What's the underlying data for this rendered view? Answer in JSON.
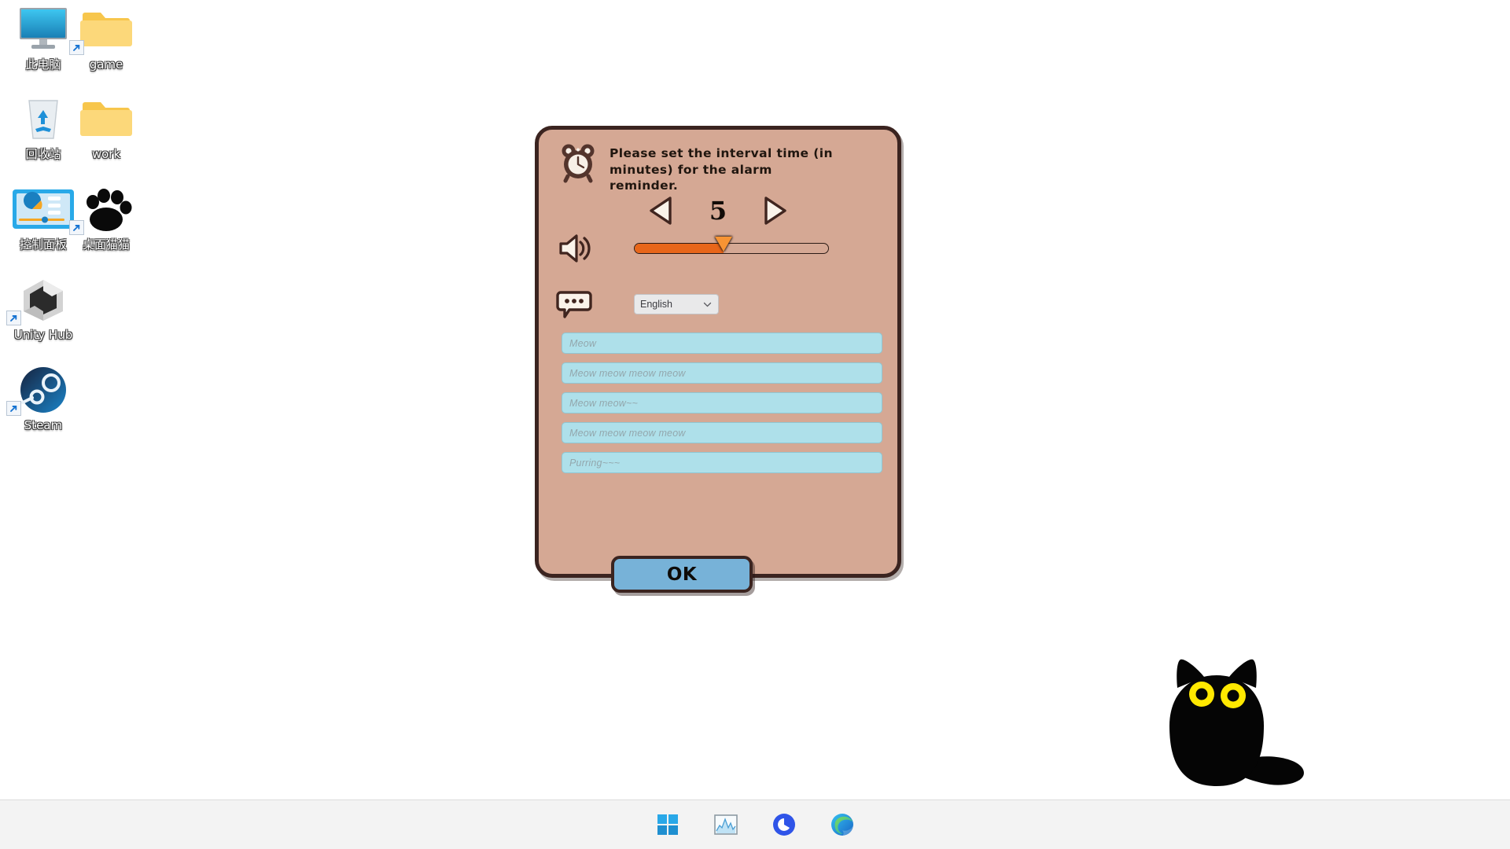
{
  "desktop": {
    "icons": [
      {
        "label": "此电脑",
        "icon": "monitor-icon",
        "shortcut": false
      },
      {
        "label": "game",
        "icon": "folder-icon",
        "shortcut": true
      },
      {
        "label": "回收站",
        "icon": "recycle-bin-icon",
        "shortcut": false
      },
      {
        "label": "work",
        "icon": "folder-icon",
        "shortcut": false
      },
      {
        "label": "控制面板",
        "icon": "control-panel-icon",
        "shortcut": false
      },
      {
        "label": "桌面猫猫",
        "icon": "paw-icon",
        "shortcut": true
      },
      {
        "label": "Unity Hub",
        "icon": "unity-icon",
        "shortcut": true
      },
      {
        "label": "Steam",
        "icon": "steam-icon",
        "shortcut": true
      }
    ]
  },
  "dialog": {
    "icon": "alarm-clock-icon",
    "message": "Please set the interval time (in minutes) for the alarm reminder.",
    "interval": {
      "value": "5",
      "decrement_icon": "triangle-left-icon",
      "increment_icon": "triangle-right-icon"
    },
    "volume": {
      "icon": "speaker-icon",
      "percent": 46
    },
    "language": {
      "icon": "speech-bubble-icon",
      "selected": "English",
      "chevron_icon": "chevron-down-icon"
    },
    "fields": [
      {
        "placeholder": "Meow"
      },
      {
        "placeholder": "Meow meow meow meow"
      },
      {
        "placeholder": "Meow meow~~"
      },
      {
        "placeholder": "Meow meow meow meow"
      },
      {
        "placeholder": "Purring~~~"
      }
    ],
    "ok_label": "OK",
    "colors": {
      "body": "#d5a894",
      "border": "#3b2420",
      "slider_fill": "#e8661a",
      "slider_handle": "#f79434",
      "field_bg": "#aee0ea",
      "ok_bg": "#77b2d8"
    }
  },
  "cat": {
    "name": "desktop-cat",
    "body_color": "#050505",
    "eye_color": "#ffe800"
  },
  "taskbar": {
    "items": [
      {
        "name": "start-button",
        "icon": "windows-logo-icon"
      },
      {
        "name": "task-manager-button",
        "icon": "chart-icon"
      },
      {
        "name": "app-button",
        "icon": "blue-circle-icon"
      },
      {
        "name": "edge-button",
        "icon": "edge-icon"
      }
    ]
  }
}
